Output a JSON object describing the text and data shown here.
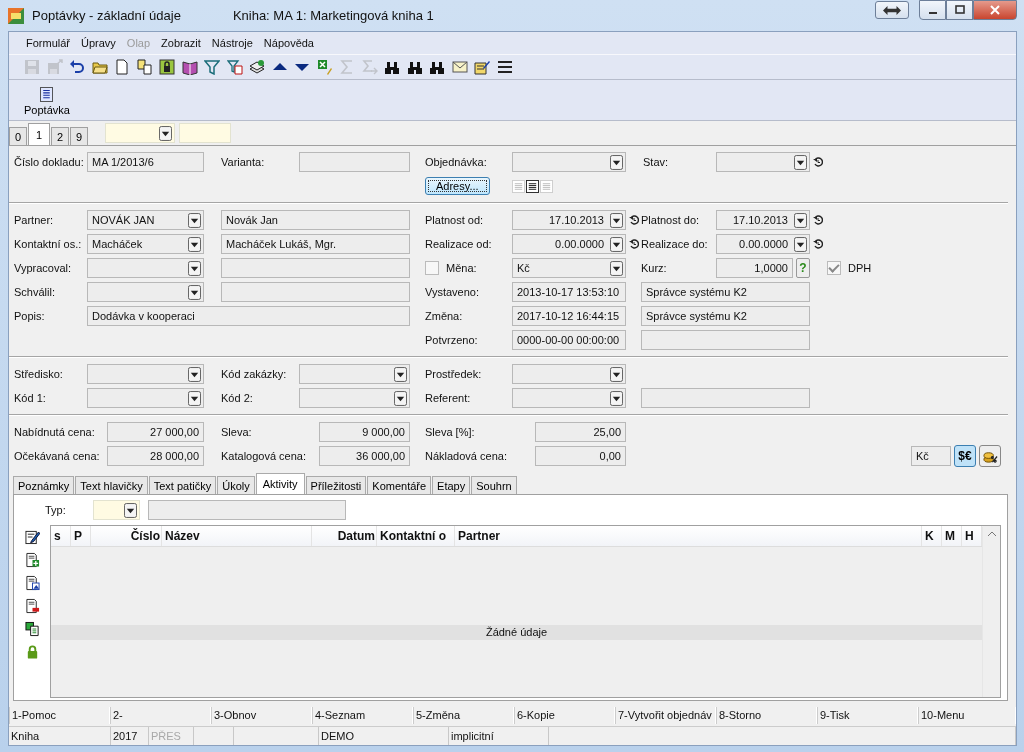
{
  "window": {
    "title": "Poptávky - základní údaje",
    "book": "Kniha: MA 1: Marketingová kniha 1"
  },
  "menu": [
    {
      "label": "Formulář",
      "disabled": false
    },
    {
      "label": "Úpravy",
      "disabled": false
    },
    {
      "label": "Olap",
      "disabled": true
    },
    {
      "label": "Zobrazit",
      "disabled": false
    },
    {
      "label": "Nástroje",
      "disabled": false
    },
    {
      "label": "Nápověda",
      "disabled": false
    }
  ],
  "toolbar": [
    {
      "kind": "save",
      "disabled": true
    },
    {
      "kind": "save-as",
      "disabled": true
    },
    {
      "kind": "undo",
      "disabled": false
    },
    {
      "kind": "folder",
      "disabled": false
    },
    {
      "kind": "page",
      "disabled": false
    },
    {
      "kind": "copy",
      "disabled": false
    },
    {
      "kind": "lock",
      "disabled": false
    },
    {
      "kind": "book",
      "disabled": false
    },
    {
      "kind": "filter",
      "disabled": false
    },
    {
      "kind": "filter-page",
      "disabled": false
    },
    {
      "kind": "stack",
      "disabled": false
    },
    {
      "kind": "up",
      "disabled": false
    },
    {
      "kind": "down",
      "disabled": false
    },
    {
      "kind": "sheet",
      "disabled": false
    },
    {
      "kind": "sum",
      "disabled": true
    },
    {
      "kind": "sum-arrow",
      "disabled": true
    },
    {
      "kind": "binoculars",
      "disabled": false
    },
    {
      "kind": "binoculars",
      "disabled": false
    },
    {
      "kind": "binoculars",
      "disabled": false
    },
    {
      "kind": "mail",
      "disabled": false
    },
    {
      "kind": "notepad",
      "disabled": false
    },
    {
      "kind": "lines",
      "disabled": false
    }
  ],
  "ribbon": [
    {
      "label": "Poptávka"
    }
  ],
  "page_tabs": [
    {
      "label": "0",
      "selected": false
    },
    {
      "label": "1",
      "selected": true
    },
    {
      "label": "2",
      "selected": false
    },
    {
      "label": "9",
      "selected": false
    }
  ],
  "form": {
    "cislo_dokladu": {
      "label": "Číslo dokladu:",
      "value": "MA 1/2013/6"
    },
    "varianta": {
      "label": "Varianta:"
    },
    "objednavka": {
      "label": "Objednávka:"
    },
    "stav": {
      "label": "Stav:"
    },
    "adresy_button": "Adresy...",
    "text_align": [
      {
        "selected": false
      },
      {
        "selected": true
      },
      {
        "selected": false
      }
    ],
    "partner": {
      "label": "Partner:",
      "value": "NOVÁK JAN",
      "name": "Novák Jan"
    },
    "kontaktni_osoba": {
      "label": "Kontaktní os.:",
      "value": "Macháček",
      "name": "Macháček Lukáš, Mgr."
    },
    "vypracoval": {
      "label": "Vypracoval:"
    },
    "schvalil": {
      "label": "Schválil:"
    },
    "popis": {
      "label": "Popis:",
      "value": "Dodávka v kooperaci"
    },
    "platnost_od": {
      "label": "Platnost od:",
      "value": "17.10.2013"
    },
    "platnost_do": {
      "label": "Platnost do:",
      "value": "17.10.2013"
    },
    "realizace_od": {
      "label": "Realizace od:",
      "value": "0.00.0000"
    },
    "realizace_do": {
      "label": "Realizace do:",
      "value": "0.00.0000"
    },
    "mena": {
      "label": "Měna:",
      "checked": false,
      "value": "Kč"
    },
    "kurz": {
      "label": "Kurz:",
      "value": "1,0000",
      "help": "?"
    },
    "dph": {
      "label": "DPH",
      "checked": true
    },
    "vystaveno": {
      "label": "Vystaveno:",
      "value": "2013-10-17 13:53:10",
      "user": "Správce systému K2"
    },
    "zmena": {
      "label": "Změna:",
      "value": "2017-10-12 16:44:15",
      "user": "Správce systému K2"
    },
    "potvrzeno": {
      "label": "Potvrzeno:",
      "value": "0000-00-00 00:00:00"
    },
    "stredisko": {
      "label": "Středisko:"
    },
    "kod_zakazky": {
      "label": "Kód zakázky:"
    },
    "prostredek": {
      "label": "Prostředek:"
    },
    "kod_1": {
      "label": "Kód 1:"
    },
    "kod_2": {
      "label": "Kód 2:"
    },
    "referent": {
      "label": "Referent:"
    },
    "nabidnuta_cena": {
      "label": "Nabídnutá cena:",
      "value": "27 000,00"
    },
    "sleva": {
      "label": "Sleva:",
      "value": "9 000,00"
    },
    "sleva_procent": {
      "label": "Sleva [%]:",
      "value": "25,00"
    },
    "ocekavana_cena": {
      "label": "Očekávaná cena:",
      "value": "28 000,00"
    },
    "katalogova_cena": {
      "label": "Katalogová cena:",
      "value": "36 000,00"
    },
    "nakladova_cena": {
      "label": "Nákladová cena:",
      "value": "0,00"
    },
    "currency": "Kč",
    "currency_button": "$€"
  },
  "detail_tabs": [
    {
      "label": "Poznámky",
      "selected": false
    },
    {
      "label": "Text hlavičky",
      "selected": false
    },
    {
      "label": "Text patičky",
      "selected": false
    },
    {
      "label": "Úkoly",
      "selected": false
    },
    {
      "label": "Aktivity",
      "selected": true
    },
    {
      "label": "Příležitosti",
      "selected": false
    },
    {
      "label": "Komentáře",
      "selected": false
    },
    {
      "label": "Etapy",
      "selected": false
    },
    {
      "label": "Souhrn",
      "selected": false
    }
  ],
  "activities": {
    "type_label": "Typ:",
    "columns": [
      "s",
      "P",
      "Číslo",
      "Název",
      "Datum",
      "Kontaktní o",
      "Partner",
      "K",
      "M",
      "H"
    ],
    "empty_text": "Žádné údaje"
  },
  "function_keys": [
    "1-Pomoc",
    "2-",
    "3-Obnov",
    "4-Seznam",
    "5-Změna",
    "6-Kopie",
    "7-Vytvořit objednáv",
    "8-Storno",
    "9-Tisk",
    "10-Menu"
  ],
  "status_bar": [
    {
      "text": "Kniha",
      "disabled": false
    },
    {
      "text": "2017",
      "disabled": false
    },
    {
      "text": "PŘES",
      "disabled": true
    },
    {
      "text": "DEMO",
      "disabled": false
    },
    {
      "text": "implicitní",
      "disabled": false
    }
  ]
}
